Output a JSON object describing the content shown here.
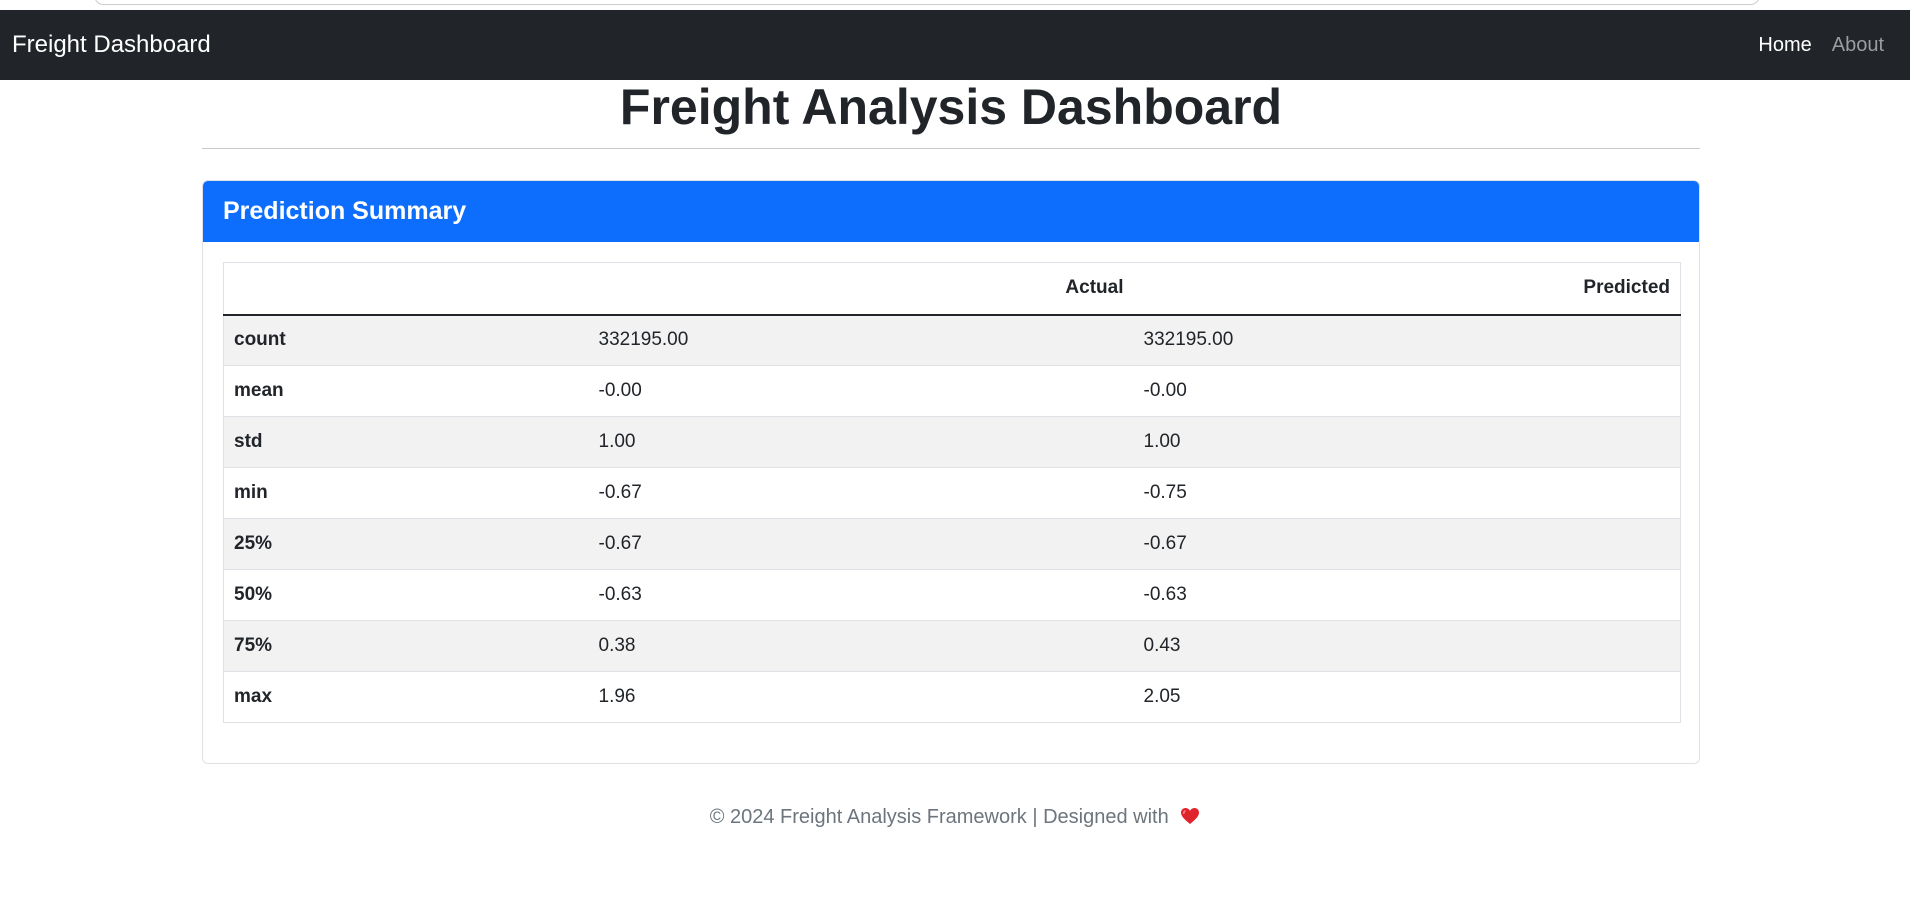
{
  "navbar": {
    "brand": "Freight Dashboard",
    "links": [
      {
        "label": "Home",
        "active": true
      },
      {
        "label": "About",
        "active": false
      }
    ]
  },
  "page": {
    "title": "Freight Analysis Dashboard"
  },
  "card": {
    "header": "Prediction Summary",
    "header_color": "#0d6efd"
  },
  "table": {
    "columns": [
      "",
      "Actual",
      "Predicted"
    ],
    "rows": [
      {
        "label": "count",
        "actual": "332195.00",
        "predicted": "332195.00"
      },
      {
        "label": "mean",
        "actual": "-0.00",
        "predicted": "-0.00"
      },
      {
        "label": "std",
        "actual": "1.00",
        "predicted": "1.00"
      },
      {
        "label": "min",
        "actual": "-0.67",
        "predicted": "-0.75"
      },
      {
        "label": "25%",
        "actual": "-0.67",
        "predicted": "-0.67"
      },
      {
        "label": "50%",
        "actual": "-0.63",
        "predicted": "-0.63"
      },
      {
        "label": "75%",
        "actual": "0.38",
        "predicted": "0.43"
      },
      {
        "label": "max",
        "actual": "1.96",
        "predicted": "2.05"
      }
    ]
  },
  "footer": {
    "text": "© 2024 Freight Analysis Framework | Designed with",
    "icon": "heart-icon",
    "icon_color": "#e0242b"
  }
}
